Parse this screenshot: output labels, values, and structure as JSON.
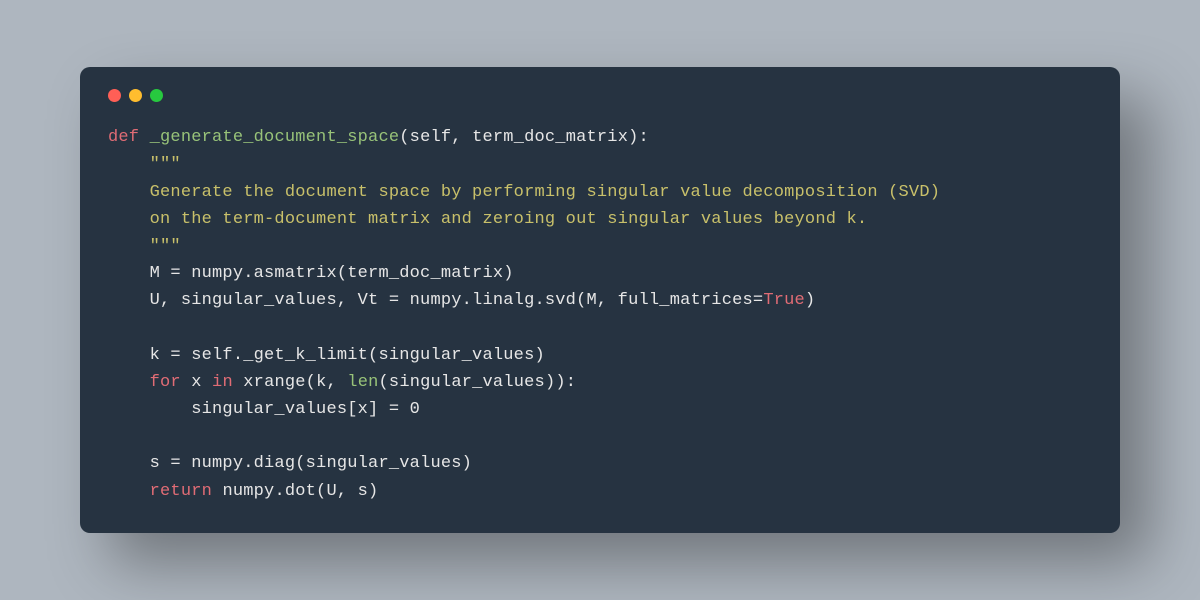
{
  "colors": {
    "background": "#aeb6bf",
    "window": "#263341",
    "dotRed": "#ff5f56",
    "dotYellow": "#ffbd2e",
    "dotGreen": "#27c93f",
    "keyword": "#e06c75",
    "function": "#98c379",
    "docstring": "#c8c06a",
    "text": "#e6e6e6"
  },
  "code": {
    "line1": {
      "kw_def": "def",
      "sp1": " ",
      "func": "_generate_document_space",
      "lparen": "(",
      "params": "self, term_doc_matrix",
      "rparen_colon": "):"
    },
    "line2": {
      "indent": "    ",
      "triq": "\"\"\""
    },
    "line3": {
      "indent": "    ",
      "text": "Generate the document space by performing singular value decomposition (SVD)"
    },
    "line4": {
      "indent": "    ",
      "text": "on the term-document matrix and zeroing out singular values beyond k."
    },
    "line5": {
      "indent": "    ",
      "triq": "\"\"\""
    },
    "line6": {
      "indent": "    ",
      "text": "M = numpy.asmatrix(term_doc_matrix)"
    },
    "line7": {
      "indent": "    ",
      "pre": "U, singular_values, Vt = numpy.linalg.svd(M, full_matrices=",
      "const": "True",
      "post": ")"
    },
    "line8": "",
    "line9": {
      "indent": "    ",
      "text": "k = self._get_k_limit(singular_values)"
    },
    "line10": {
      "indent": "    ",
      "kw_for": "for",
      "sp1": " ",
      "var": "x",
      "sp2": " ",
      "kw_in": "in",
      "sp3": " ",
      "xrange": "xrange(k, ",
      "len": "len",
      "post": "(singular_values)):"
    },
    "line11": {
      "indent": "        ",
      "text": "singular_values[x] = 0"
    },
    "line12": "",
    "line13": {
      "indent": "    ",
      "text": "s = numpy.diag(singular_values)"
    },
    "line14": {
      "indent": "    ",
      "kw_return": "return",
      "sp": " ",
      "text": "numpy.dot(U, s)"
    }
  }
}
